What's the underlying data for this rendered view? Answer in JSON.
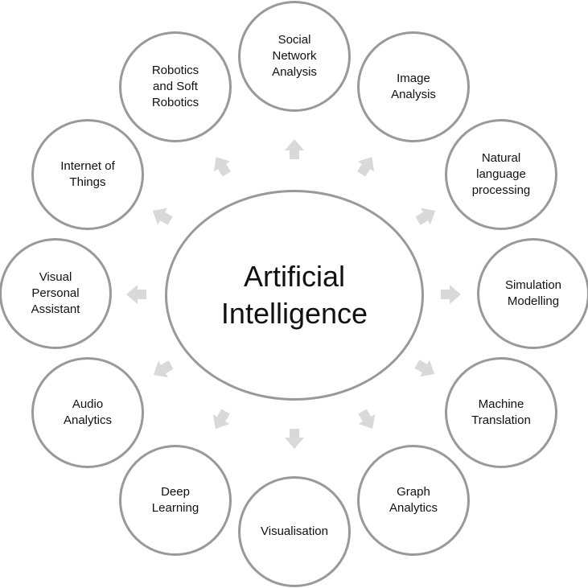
{
  "center": {
    "label": "Artificial\nIntelligence"
  },
  "nodes": [
    {
      "id": "social-network-analysis",
      "label": "Social\nNetwork\nAnalysis"
    },
    {
      "id": "image-analysis",
      "label": "Image\nAnalysis"
    },
    {
      "id": "natural-language-processing",
      "label": "Natural\nlanguage\nprocessing"
    },
    {
      "id": "simulation-modelling",
      "label": "Simulation\nModelling"
    },
    {
      "id": "machine-translation",
      "label": "Machine\nTranslation"
    },
    {
      "id": "graph-analytics",
      "label": "Graph\nAnalytics"
    },
    {
      "id": "visualisation",
      "label": "Visualisation"
    },
    {
      "id": "deep-learning",
      "label": "Deep\nLearning"
    },
    {
      "id": "audio-analytics",
      "label": "Audio\nAnalytics"
    },
    {
      "id": "visual-personal-assistant",
      "label": "Visual\nPersonal\nAssistant"
    },
    {
      "id": "internet-of-things",
      "label": "Internet of\nThings"
    },
    {
      "id": "robotics-and-soft-robotics",
      "label": "Robotics\nand Soft\nRobotics"
    }
  ],
  "colors": {
    "circle_border": "#999999",
    "arrow_fill": "#d9d9d9",
    "text": "#111111"
  }
}
